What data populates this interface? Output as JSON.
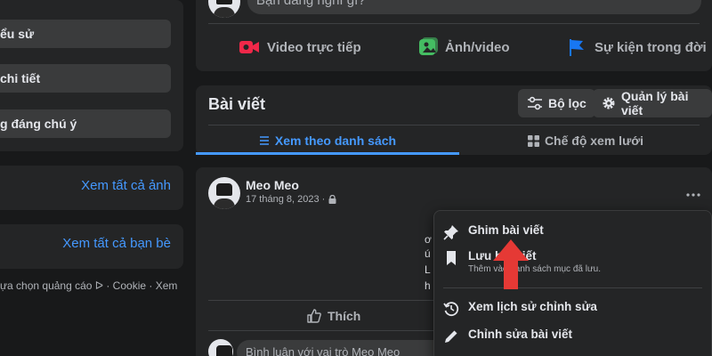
{
  "left": {
    "menu_items": [
      "ểu sử",
      "chi tiết",
      "g đáng chú ý"
    ],
    "see_all_photos": "Xem tất cả ảnh",
    "see_all_friends": "Xem tất cả bạn bè",
    "footer": "ựa chọn quảng cáo ᐅ · Cookie · Xem"
  },
  "composer": {
    "placeholder": "Bạn đang nghĩ gì?",
    "actions": [
      {
        "label": "Video trực tiếp",
        "icon": "live-video-icon",
        "color": "#f02849"
      },
      {
        "label": "Ảnh/video",
        "icon": "photo-icon",
        "color": "#45bd62"
      },
      {
        "label": "Sự kiện trong đời",
        "icon": "flag-icon",
        "color": "#1877f2"
      }
    ]
  },
  "posts_header": {
    "title": "Bài viết",
    "filter_label": "Bộ lọc",
    "manage_label": "Quản lý bài viết",
    "tab_list": "Xem theo danh sách",
    "tab_grid": "Chế độ xem lưới"
  },
  "post": {
    "author": "Meo Meo",
    "date": "17 tháng 8, 2023 ·",
    "body_fragments": [
      "ơ",
      "ú",
      "L",
      "h"
    ],
    "body_right_fragments": [
      "c"
    ],
    "like_label": "Thích",
    "comment_placeholder": "Bình luận với vai trò Meo Meo"
  },
  "menu": {
    "pin_label": "Ghim bài viết",
    "save_label": "Lưu bài viết",
    "save_sub": "Thêm vào danh sách mục đã lưu.",
    "history_label": "Xem lịch sử chỉnh sửa",
    "edit_label": "Chỉnh sửa bài viết"
  },
  "colors": {
    "accent": "#4599ff",
    "arrow": "#e53935"
  }
}
